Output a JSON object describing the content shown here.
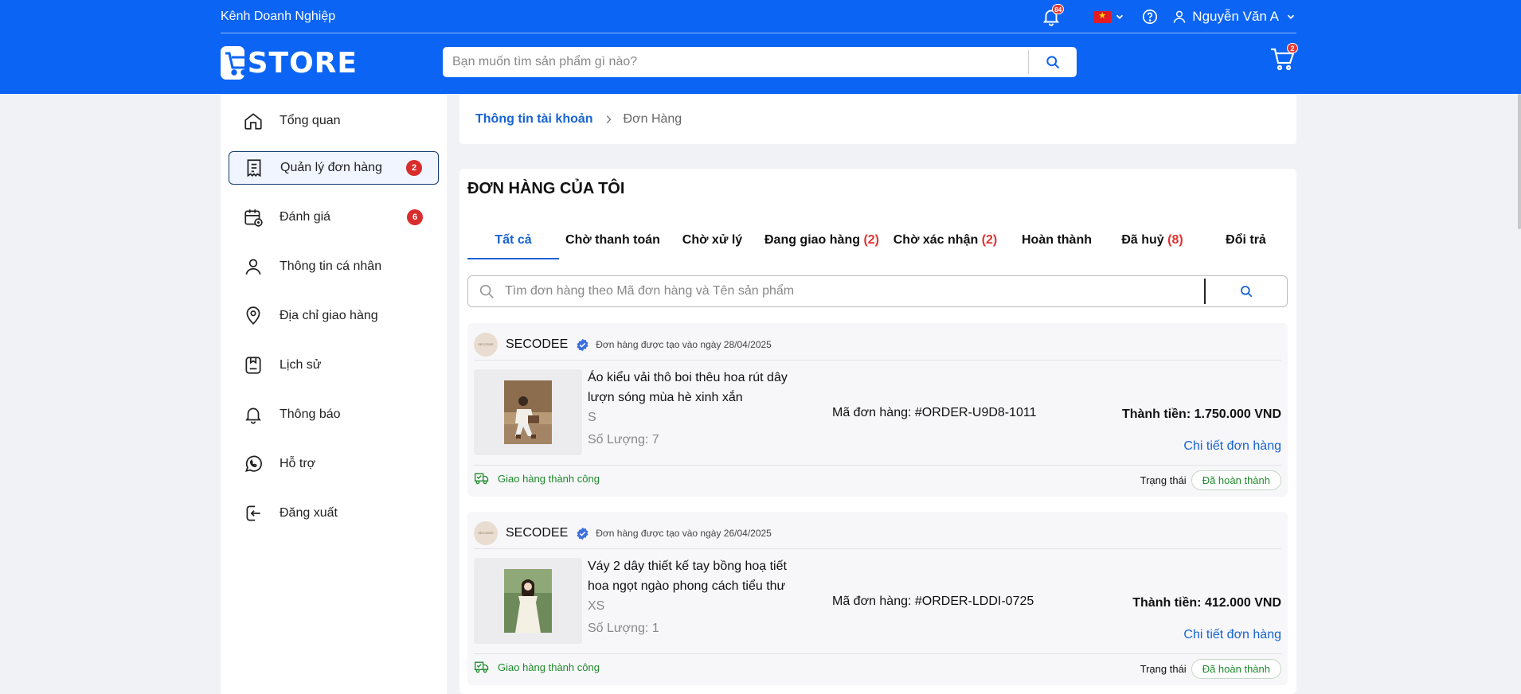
{
  "header": {
    "business_link": "Kênh Doanh Nghiệp",
    "notification_count": "84",
    "user_name": "Nguyễn Văn A",
    "logo_text": "STORE",
    "search_placeholder": "Bạn muốn tìm sản phẩm gì nào?",
    "cart_count": "2",
    "brand_color": "#0b64f4"
  },
  "sidebar": {
    "items": [
      {
        "label": "Tổng quan",
        "icon": "home-icon",
        "count": ""
      },
      {
        "label": "Quản lý đơn hàng",
        "icon": "receipt-icon",
        "count": "2"
      },
      {
        "label": "Đánh giá",
        "icon": "calendar-review-icon",
        "count": "6"
      },
      {
        "label": "Thông tin cá nhân",
        "icon": "user-icon",
        "count": ""
      },
      {
        "label": "Địa chỉ giao hàng",
        "icon": "location-pin-icon",
        "count": ""
      },
      {
        "label": "Lịch sử",
        "icon": "history-icon",
        "count": ""
      },
      {
        "label": "Thông báo",
        "icon": "bell-icon",
        "count": ""
      },
      {
        "label": "Hỗ trợ",
        "icon": "phone-support-icon",
        "count": ""
      },
      {
        "label": "Đăng xuất",
        "icon": "logout-icon",
        "count": ""
      }
    ]
  },
  "breadcrumb": {
    "link": "Thông tin tài khoản",
    "current": "Đơn Hàng"
  },
  "orders_page": {
    "title": "ĐƠN HÀNG CỦA TÔI",
    "tabs": [
      {
        "label": "Tất cả",
        "count": ""
      },
      {
        "label": "Chờ thanh toán",
        "count": ""
      },
      {
        "label": "Chờ xử lý",
        "count": ""
      },
      {
        "label": "Đang giao hàng",
        "count": "(2)"
      },
      {
        "label": "Chờ xác nhận",
        "count": "(2)"
      },
      {
        "label": "Hoàn thành",
        "count": ""
      },
      {
        "label": "Đã huỷ",
        "count": "(8)"
      },
      {
        "label": "Đổi trả",
        "count": ""
      }
    ],
    "search_placeholder": "Tìm đơn hàng theo Mã đơn hàng và Tên sản phẩm",
    "orders": [
      {
        "shop": "SECODEE",
        "shop_avatar_text": "SECODEE",
        "created": "Đơn hàng được tạo vào ngày 28/04/2025",
        "product_name": "Áo kiểu vải thô boi thêu hoa rút dây lượn sóng mùa hè xinh xắn",
        "variant": "S",
        "quantity": "Số Lượng: 7",
        "order_code": "Mã đơn hàng: #ORDER-U9D8-1011",
        "total": "Thành tiền: 1.750.000 VND",
        "detail_link": "Chi tiết đơn hàng",
        "shipping": "Giao hàng thành công",
        "status_label": "Trạng thái",
        "status": "Đã hoàn thành"
      },
      {
        "shop": "SECODEE",
        "shop_avatar_text": "SECODEE",
        "created": "Đơn hàng được tạo vào ngày 26/04/2025",
        "product_name": "Váy 2 dây thiết kế tay bồng hoạ tiết hoa ngọt ngào phong cách tiểu thư",
        "variant": "XS",
        "quantity": "Số Lượng: 1",
        "order_code": "Mã đơn hàng: #ORDER-LDDI-0725",
        "total": "Thành tiền: 412.000 VND",
        "detail_link": "Chi tiết đơn hàng",
        "shipping": "Giao hàng thành công",
        "status_label": "Trạng thái",
        "status": "Đã hoàn thành"
      }
    ]
  }
}
